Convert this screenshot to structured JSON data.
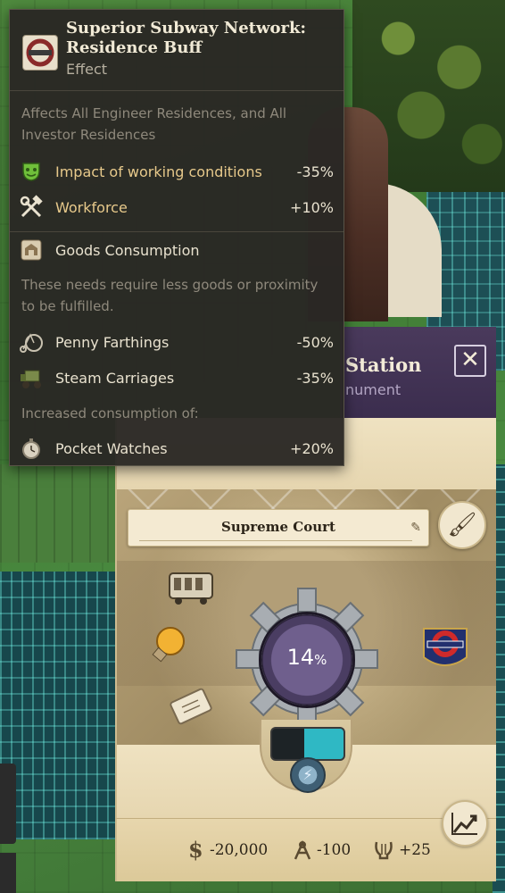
{
  "tooltip": {
    "title": "Superior Subway Network: Residence Buff",
    "subtitle": "Effect",
    "affects": "Affects All Engineer Residences, and All Investor Residences",
    "effects": [
      {
        "label": "Impact of working conditions",
        "value": "-35%",
        "icon": "theater-mask-icon"
      },
      {
        "label": "Workforce",
        "value": "+10%",
        "icon": "hammer-wrench-icon"
      }
    ],
    "goods_header": "Goods Consumption",
    "goods_desc": "These needs require less goods or proximity to be fulfilled.",
    "reduced": [
      {
        "label": "Penny Farthings",
        "value": "-50%",
        "icon": "penny-farthing-icon"
      },
      {
        "label": "Steam Carriages",
        "value": "-35%",
        "icon": "steam-carriage-icon"
      }
    ],
    "increased_header": "Increased consumption of:",
    "increased": [
      {
        "label": "Pocket Watches",
        "value": "+20%",
        "icon": "pocket-watch-icon"
      }
    ]
  },
  "panel": {
    "title": "Station",
    "subtitle": "nument",
    "close_label": "✕",
    "name_value": "Supreme Court",
    "progress_text": "14",
    "progress_unit": "%",
    "progress": 0.14,
    "stats": {
      "money": "-20,000",
      "influence": "-100",
      "attractiveness": "+25"
    }
  },
  "colors": {
    "tooltip_bg": "#2a2824",
    "panel_header": "#3b2d4e",
    "panel_cream": "#efe2c1",
    "gold_text": "#e7c98b"
  }
}
